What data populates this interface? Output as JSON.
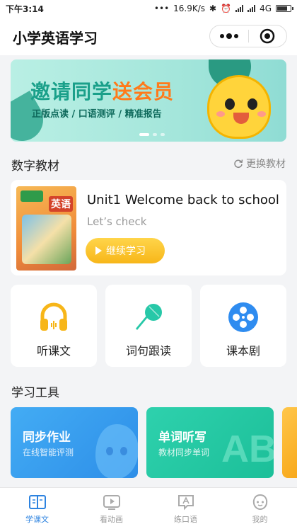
{
  "status_bar": {
    "time": "下午3:14",
    "network_speed": "16.9K/s",
    "network_type": "4G",
    "battery_level": 0.85
  },
  "header": {
    "title": "小学英语学习",
    "menu_icon": "more-dots-icon",
    "close_icon": "target-close-icon"
  },
  "banner": {
    "headline_part1": "邀请同学",
    "headline_part2": "送会员",
    "subtitle": "正版点读 / 口语测评 / 精准报告",
    "slide_count": 3,
    "active_slide": 1
  },
  "textbook_section": {
    "title": "数字教材",
    "change_label": "更换教材"
  },
  "current_book": {
    "cover_word": "英语",
    "unit_title": "Unit1 Welcome back to school",
    "lesson": "Let’s check",
    "continue_label": "继续学习"
  },
  "features": [
    {
      "label": "听课文",
      "icon": "headphones-icon"
    },
    {
      "label": "词句跟读",
      "icon": "microphone-icon"
    },
    {
      "label": "课本剧",
      "icon": "film-reel-icon"
    }
  ],
  "tools_section": {
    "title": "学习工具"
  },
  "tools": [
    {
      "title": "同步作业",
      "subtitle": "在线智能评测",
      "color": "#3aa6f0"
    },
    {
      "title": "单词听写",
      "subtitle": "教材同步单词",
      "color": "#24c7a3"
    }
  ],
  "tab_bar": [
    {
      "label": "学课文",
      "icon": "book-icon",
      "active": true
    },
    {
      "label": "看动画",
      "icon": "video-play-icon",
      "active": false
    },
    {
      "label": "练口语",
      "icon": "speech-bubble-icon",
      "active": false
    },
    {
      "label": "我的",
      "icon": "profile-face-icon",
      "active": false
    }
  ],
  "colors": {
    "accent_blue": "#2d83e0",
    "button_yellow": "#f7b619",
    "banner_teal": "#1aa08a",
    "banner_orange": "#ff7a1a"
  }
}
